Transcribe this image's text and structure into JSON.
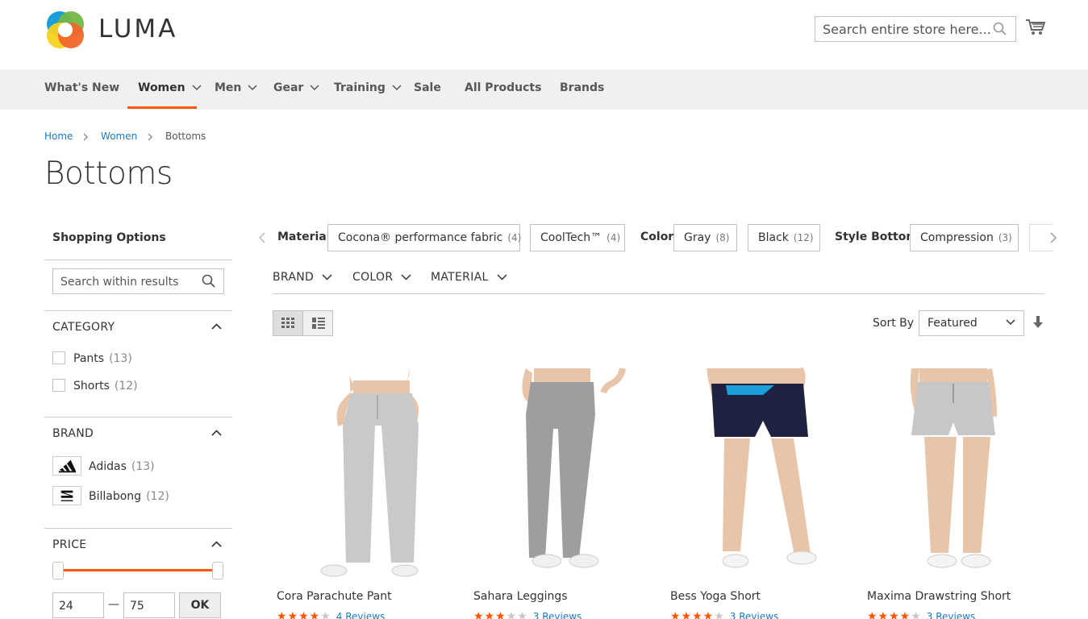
{
  "brand": {
    "name": "LUMA",
    "colors": {
      "accent": "#ff5501",
      "link": "#1979c3"
    }
  },
  "header": {
    "search_placeholder": "Search entire store here...",
    "cart_icon": "cart-icon"
  },
  "nav": {
    "items": [
      {
        "label": "What's New"
      },
      {
        "label": "Women",
        "active": true
      },
      {
        "label": "Men"
      },
      {
        "label": "Gear"
      },
      {
        "label": "Training"
      },
      {
        "label": "Sale"
      },
      {
        "label": "All Products"
      },
      {
        "label": "Brands"
      }
    ]
  },
  "breadcrumb": {
    "items": [
      "Home",
      "Women",
      "Bottoms"
    ]
  },
  "page": {
    "title": "Bottoms"
  },
  "sidebar": {
    "title": "Shopping Options",
    "search_placeholder": "Search within results",
    "category": {
      "heading": "CATEGORY",
      "options": [
        {
          "label": "Pants",
          "count": "(13)"
        },
        {
          "label": "Shorts",
          "count": "(12)"
        }
      ]
    },
    "brand": {
      "heading": "BRAND",
      "options": [
        {
          "label": "Adidas",
          "count": "(13)"
        },
        {
          "label": "Billabong",
          "count": "(12)"
        }
      ]
    },
    "price": {
      "heading": "PRICE",
      "min": "24",
      "max": "75",
      "separator": "—",
      "ok": "OK"
    }
  },
  "chips": {
    "groups": [
      {
        "label": "Material",
        "chips": [
          {
            "text": "Cocona® performance fabric",
            "count": "(4)"
          },
          {
            "text": "CoolTech™",
            "count": "(4)"
          }
        ]
      },
      {
        "label": "Color",
        "chips": [
          {
            "text": "Gray",
            "count": "(8)"
          },
          {
            "text": "Black",
            "count": "(12)"
          }
        ]
      },
      {
        "label": "Style Bottom",
        "chips": [
          {
            "text": "Compression",
            "count": "(3)"
          }
        ]
      }
    ]
  },
  "dropdown_filters": [
    "BRAND",
    "COLOR",
    "MATERIAL"
  ],
  "toolbar": {
    "sort_label": "Sort By",
    "sort_value": "Featured"
  },
  "products": [
    {
      "name": "Cora Parachute Pant",
      "rating": 4,
      "reviews": "4 Reviews"
    },
    {
      "name": "Sahara Leggings",
      "rating": 3,
      "reviews": "3 Reviews"
    },
    {
      "name": "Bess Yoga Short",
      "rating": 4,
      "reviews": "3 Reviews"
    },
    {
      "name": "Maxima Drawstring Short",
      "rating": 4,
      "reviews": "3 Reviews"
    }
  ]
}
